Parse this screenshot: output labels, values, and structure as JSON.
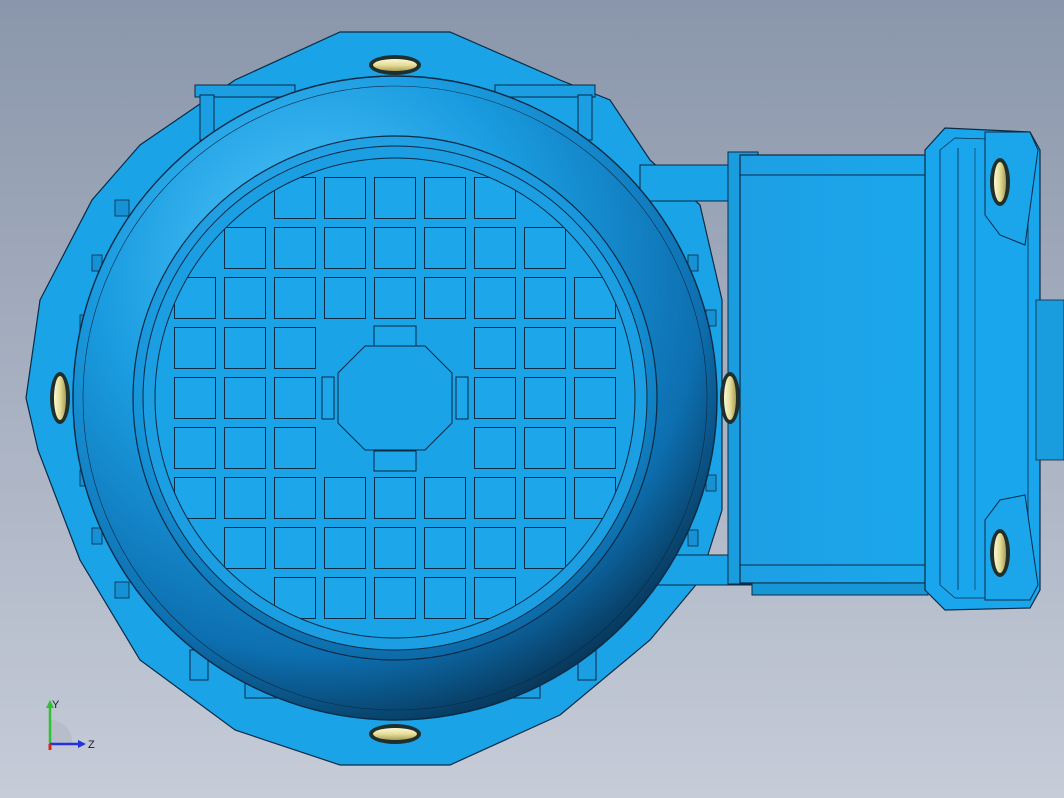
{
  "viewport": {
    "background_top": "#8a96ab",
    "background_bottom": "#c6ccd8"
  },
  "model": {
    "body_color": "#1aa3e6",
    "dark_color": "#0a5a8c",
    "edge_color": "#0b2a45",
    "bolt_color": "#e9e2a2",
    "grille_rows": 9,
    "grille_cols": 9
  },
  "triad": {
    "y_label": "Y",
    "z_label": "Z",
    "y_color": "#2fc12f",
    "z_color": "#2233dd",
    "x_color": "#dd2222"
  }
}
